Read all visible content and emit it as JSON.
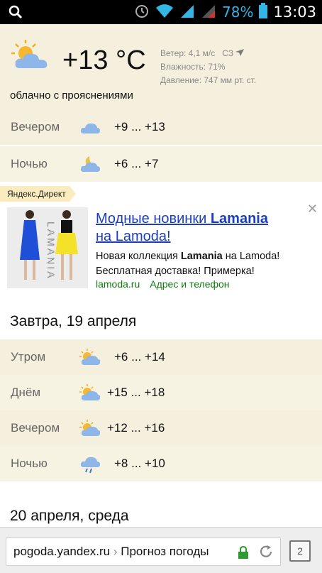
{
  "statusbar": {
    "battery_pct": "78%",
    "time": "13:03"
  },
  "current": {
    "temperature": "+13 °C",
    "wind": "Ветер: 4,1 м/с",
    "wind_dir": "СЗ",
    "humidity": "Влажность: 71%",
    "pressure": "Давление: 747 мм рт. ст.",
    "description": "облачно с прояснениями"
  },
  "today": [
    {
      "label": "Вечером",
      "from": "+9",
      "to": "+13",
      "icon": "cloud-icon"
    },
    {
      "label": "Ночью",
      "from": "+6",
      "to": "+7",
      "icon": "moon-cloud-icon"
    }
  ],
  "ad": {
    "tag": "Яндекс.Директ",
    "title_1": "Модные новинки ",
    "title_brand": "Lamania",
    "title_2": "на Lamoda!",
    "text_1": "Новая коллекция ",
    "text_brand": "Lamania",
    "text_2": " на Lamoda!",
    "text_line2": "Бесплатная доставка! Примерка!",
    "link_domain": "lamoda.ru",
    "link_address": "Адрес и телефон",
    "image_brand": "LAMANIA"
  },
  "tomorrow": {
    "heading": "Завтра, 19 апреля",
    "rows": [
      {
        "label": "Утром",
        "from": "+6",
        "to": "+14",
        "icon": "sun-cloud-icon"
      },
      {
        "label": "Днём",
        "from": "+15",
        "to": "+18",
        "icon": "sun-cloud-icon"
      },
      {
        "label": "Вечером",
        "from": "+12",
        "to": "+16",
        "icon": "sun-cloud-icon"
      },
      {
        "label": "Ночью",
        "from": "+8",
        "to": "+10",
        "icon": "rain-cloud-icon"
      }
    ]
  },
  "next_day": {
    "heading": "20 апреля, среда"
  },
  "browser": {
    "url_host": "pogoda.yandex.ru",
    "url_sep": "›",
    "url_title": "Прогноз погоды",
    "tab_count": "2"
  },
  "colors": {
    "beige": "#f5f0dd",
    "ad_link": "#1a3dc1",
    "ad_green": "#0f7a0f",
    "accent_blue": "#33b5e5"
  }
}
